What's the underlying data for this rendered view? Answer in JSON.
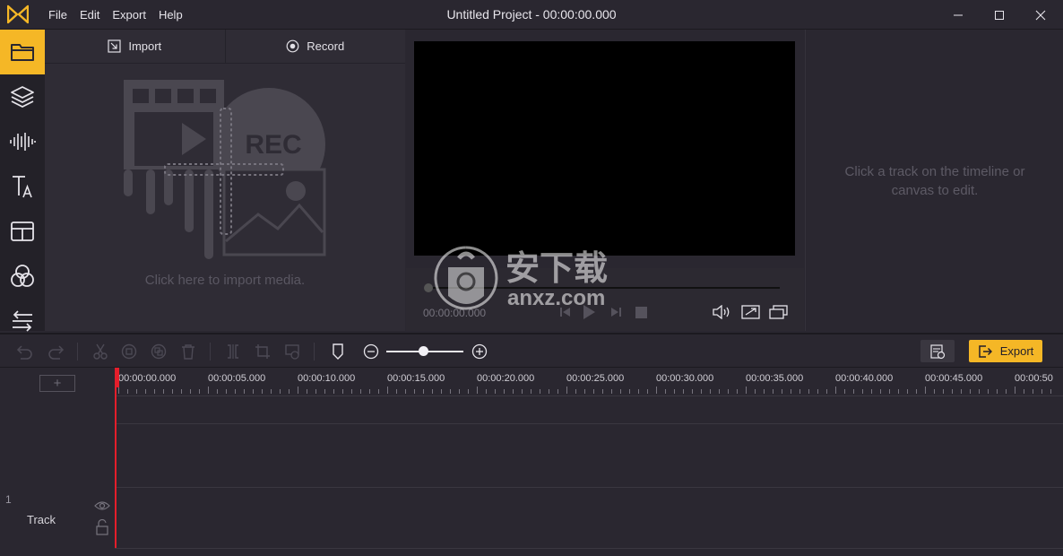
{
  "window": {
    "title": "Untitled Project - 00:00:00.000",
    "logo_icon": "app-logo-icon",
    "controls": [
      "minimize-icon",
      "maximize-icon",
      "close-icon"
    ]
  },
  "menu": {
    "items": [
      "File",
      "Edit",
      "Export",
      "Help"
    ]
  },
  "rail": {
    "items": [
      {
        "icon": "folder-icon",
        "active": true
      },
      {
        "icon": "layers-icon",
        "active": false
      },
      {
        "icon": "audio-wave-icon",
        "active": false
      },
      {
        "icon": "text-icon",
        "active": false
      },
      {
        "icon": "template-icon",
        "active": false
      },
      {
        "icon": "filter-circles-icon",
        "active": false
      },
      {
        "icon": "transition-icon",
        "active": false
      }
    ]
  },
  "media": {
    "tabs": [
      {
        "label": "Import",
        "icon": "import-icon"
      },
      {
        "label": "Record",
        "icon": "record-icon"
      }
    ],
    "illustration_text": "REC",
    "hint": "Click here to import media."
  },
  "preview": {
    "time": "00:00:00.000",
    "controls": [
      "prev-frame-icon",
      "play-icon",
      "next-frame-icon",
      "stop-icon",
      "volume-icon",
      "fit-icon",
      "fullscreen-icon"
    ]
  },
  "properties": {
    "hint_line1": "Click a track on the timeline or",
    "hint_line2": "canvas to edit."
  },
  "toolbar": {
    "export_label": "Export",
    "tools": [
      "undo-icon",
      "redo-icon",
      "cut-icon",
      "copy-icon",
      "duplicate-icon",
      "delete-icon",
      "split-icon",
      "crop-icon",
      "speed-icon",
      "marker-icon",
      "zoom-out-icon",
      "zoom-in-icon",
      "render-icon"
    ],
    "zoom_level": 0.42
  },
  "timeline": {
    "ticks": [
      "00:00:00.000",
      "00:00:05.000",
      "00:00:10.000",
      "00:00:15.000",
      "00:00:20.000",
      "00:00:25.000",
      "00:00:30.000",
      "00:00:35.000",
      "00:00:40.000",
      "00:00:45.000",
      "00:00:50"
    ],
    "tracks": [
      {
        "number": "1",
        "name": "Track"
      }
    ]
  },
  "watermark": {
    "cn_text": "安下载",
    "domain": "anxz.com"
  },
  "colors": {
    "accent": "#f5b726",
    "playhead": "#e41e2b",
    "background": "#2a2730"
  }
}
